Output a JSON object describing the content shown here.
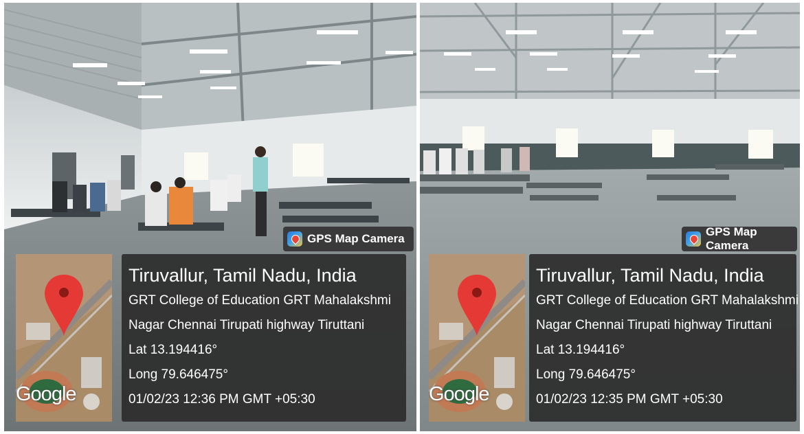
{
  "panels": [
    {
      "gps_label": "GPS Map Camera",
      "map_brand": "Google",
      "location_title": "Tiruvallur, Tamil Nadu, India",
      "address_line1": "GRT College of Education GRT Mahalakshmi",
      "address_line2": "Nagar Chennai Tirupati highway Tiruttani",
      "latitude": "Lat 13.194416°",
      "longitude": "Long 79.646475°",
      "timestamp": "01/02/23 12:36 PM GMT +05:30"
    },
    {
      "gps_label": "GPS Map Camera",
      "map_brand": "Google",
      "location_title": "Tiruvallur, Tamil Nadu, India",
      "address_line1": "GRT College of Education GRT Mahalakshmi",
      "address_line2": "Nagar Chennai Tirupati highway Tiruttani",
      "latitude": "Lat 13.194416°",
      "longitude": "Long 79.646475°",
      "timestamp": "01/02/23 12:35 PM GMT +05:30"
    }
  ],
  "colors": {
    "overlay_bg": "#2d2d2d",
    "pin_red": "#e53935",
    "text": "#ffffff"
  }
}
